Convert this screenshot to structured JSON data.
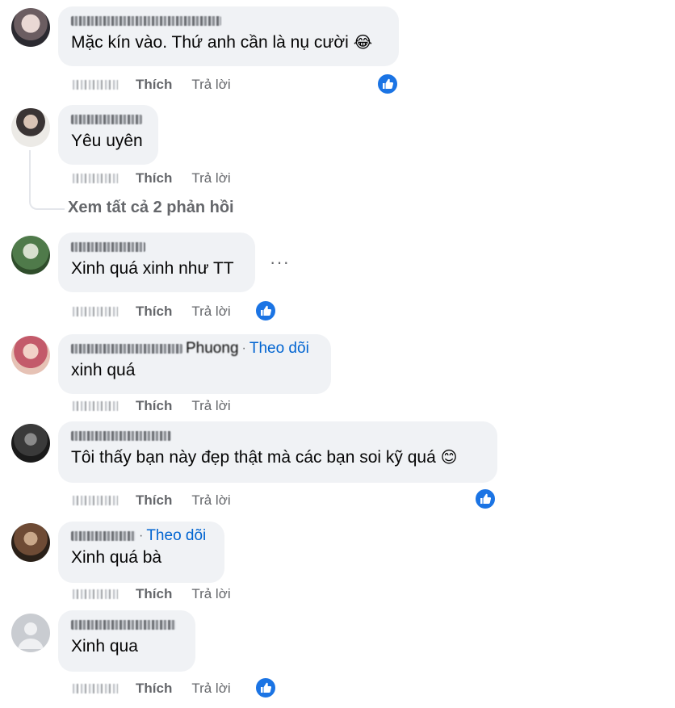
{
  "comments": [
    {
      "body": "Mặc kín vào. Thứ anh cần là nụ cười",
      "emoji": "😂",
      "actions": {
        "like": "Thích",
        "reply": "Trả lời"
      },
      "liked": true
    },
    {
      "body": "Yêu uyên",
      "actions": {
        "like": "Thích",
        "reply": "Trả lời"
      },
      "see_replies": "Xem tất cả 2 phản hồi"
    },
    {
      "body": "Xinh quá xinh như TT",
      "more": "···",
      "actions": {
        "like": "Thích",
        "reply": "Trả lời"
      },
      "liked": true
    },
    {
      "name_visible": "Phuong",
      "follow": "Theo dõi",
      "body": "xinh quá",
      "actions": {
        "like": "Thích",
        "reply": "Trả lời"
      }
    },
    {
      "body": "Tôi thấy bạn này đẹp thật mà các bạn soi kỹ quá",
      "emoji": "😊",
      "actions": {
        "like": "Thích",
        "reply": "Trả lời"
      },
      "liked": true
    },
    {
      "follow": "Theo dõi",
      "body": "Xinh quá bà",
      "actions": {
        "like": "Thích",
        "reply": "Trả lời"
      }
    },
    {
      "body": "Xinh qua",
      "actions": {
        "like": "Thích",
        "reply": "Trả lời"
      },
      "liked": true
    }
  ],
  "icons": {
    "like_badge": "thumbs-up-icon",
    "avatar_placeholder": "default-avatar-icon"
  },
  "colors": {
    "like_blue": "#1b74e4",
    "follow_blue": "#0064d1",
    "bubble": "#f0f2f5",
    "meta_gray": "#65676b"
  }
}
